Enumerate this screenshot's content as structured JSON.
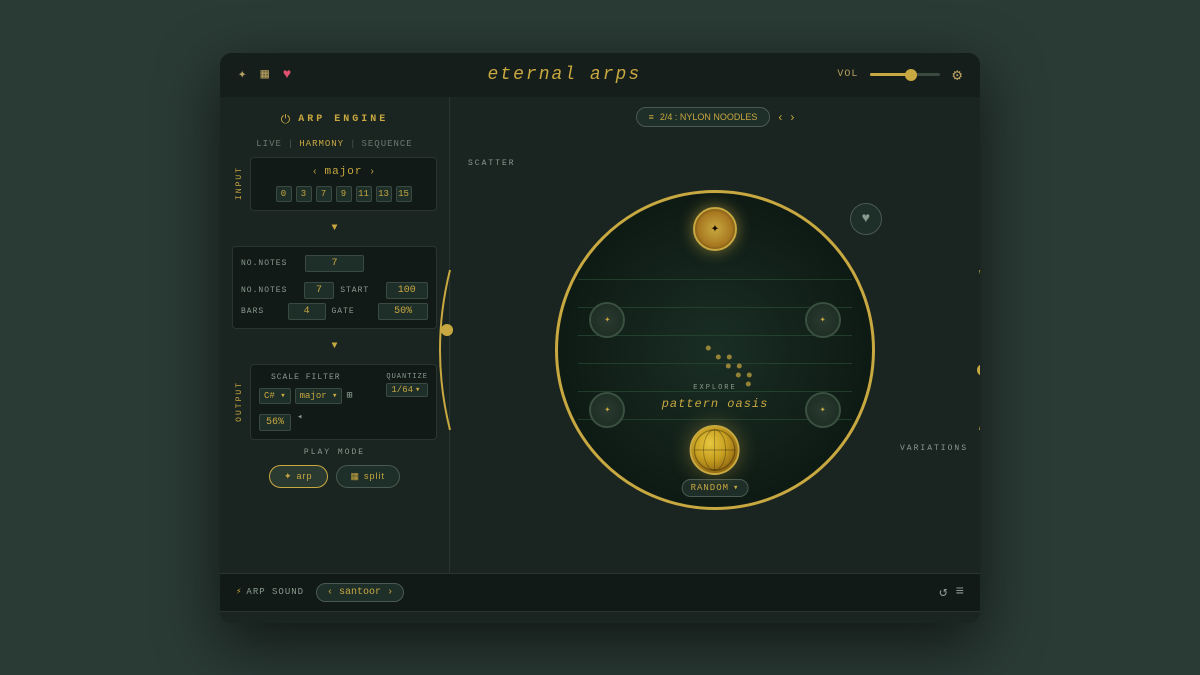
{
  "app": {
    "title": "eternal arps",
    "vol_label": "VOL"
  },
  "top_icons": {
    "move": "✦",
    "grid": "▦",
    "heart": "♥"
  },
  "arp_engine": {
    "label": "ARP ENGINE",
    "tabs": [
      "LIVE",
      "HARMONY",
      "SEQUENCE"
    ],
    "active_tab": "HARMONY"
  },
  "input": {
    "label": "INPUT",
    "scale": "major",
    "numbers": [
      "0",
      "3",
      "7",
      "9",
      "11",
      "13",
      "15"
    ]
  },
  "params": {
    "no_notes_label": "NO.NOTES",
    "no_notes_value": "7",
    "start_label": "START",
    "start_value": "100",
    "bars_label": "BARS",
    "bars_value": "4",
    "gate_label": "GATE",
    "gate_value": "50%"
  },
  "output": {
    "label": "OUTPUT",
    "scale_filter_label": "SCALE FILTER",
    "key": "C#",
    "scale": "major",
    "quantize_label": "QUANTIZE",
    "quantize_value": "1/64",
    "filter_value": "56%"
  },
  "play_mode": {
    "label": "PLAY MODE",
    "arp_label": "arp",
    "split_label": "split"
  },
  "preset": {
    "menu_icon": "≡",
    "name": "2/4 : NYLON NOODLES",
    "prev": "‹",
    "next": "›"
  },
  "visualizer": {
    "scatter_label": "SCATTER",
    "variations_label": "VARIATIONS",
    "explore_label": "EXPLORE",
    "pattern_name": "pattern oasis",
    "random_label": "RANDOM"
  },
  "arp_sound": {
    "label": "ARP SOUND",
    "sound_name": "santoor",
    "prev": "‹",
    "next": "›"
  },
  "deco": {
    "diamonds_count": 55
  }
}
